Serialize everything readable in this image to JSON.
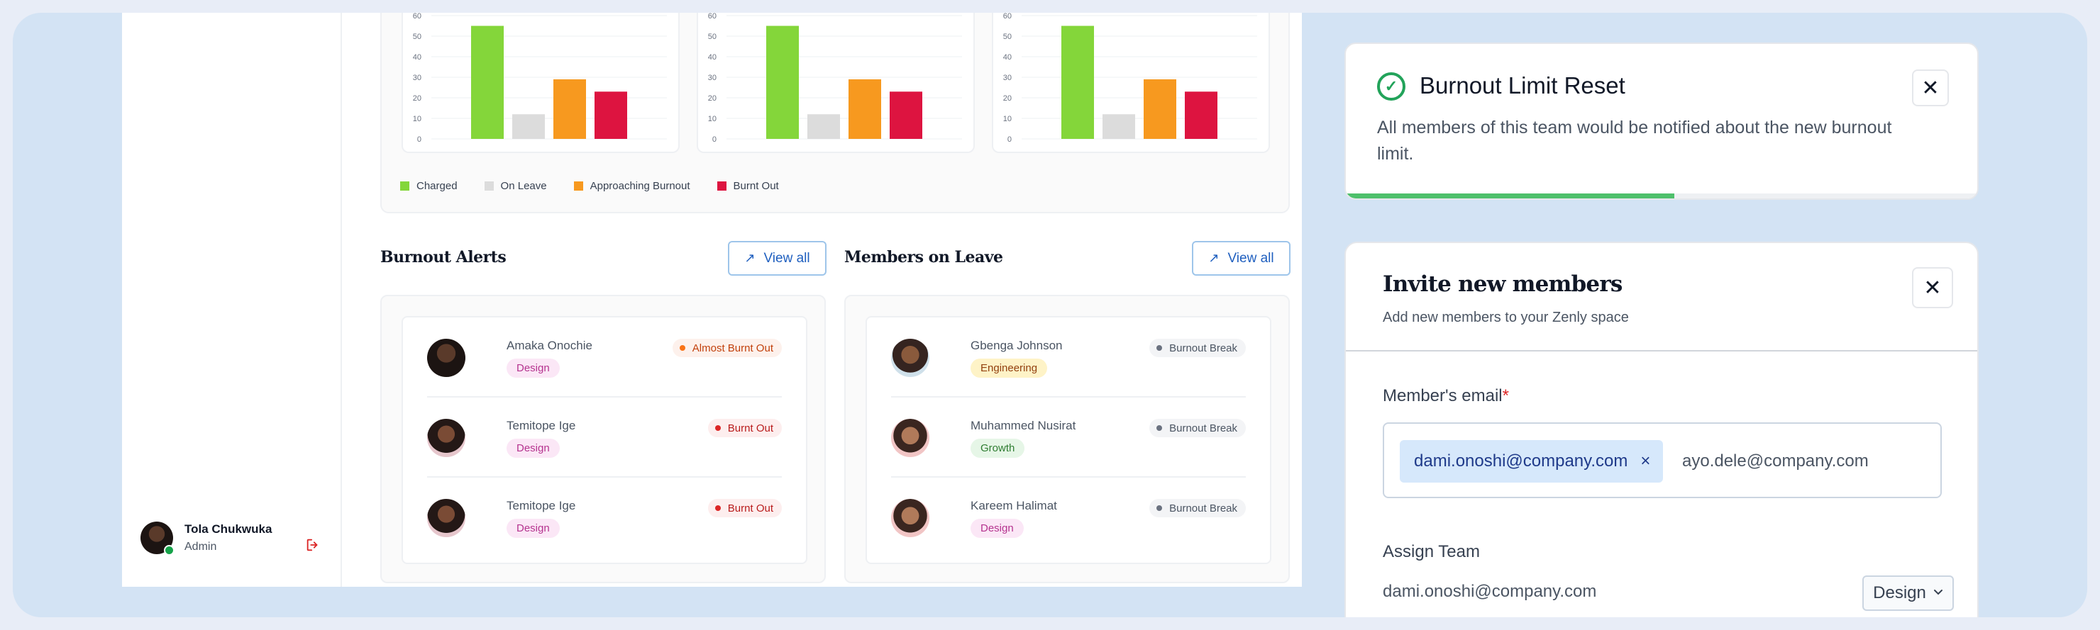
{
  "user": {
    "name": "Tola Chukwuka",
    "role": "Admin",
    "logout_icon": "logout-icon"
  },
  "chart_data": [
    {
      "type": "bar",
      "categories": [
        "Charged",
        "On Leave",
        "Approaching Burnout",
        "Burnt Out"
      ],
      "values": [
        55,
        12,
        29,
        23
      ],
      "yticks": [
        0,
        10,
        20,
        30,
        40,
        50,
        60
      ],
      "ylim": [
        0,
        60
      ],
      "colors": [
        "#84d63a",
        "#dcdcdc",
        "#f7991f",
        "#dd1440"
      ]
    },
    {
      "type": "bar",
      "categories": [
        "Charged",
        "On Leave",
        "Approaching Burnout",
        "Burnt Out"
      ],
      "values": [
        55,
        12,
        29,
        23
      ],
      "yticks": [
        0,
        10,
        20,
        30,
        40,
        50,
        60
      ],
      "ylim": [
        0,
        60
      ],
      "colors": [
        "#84d63a",
        "#dcdcdc",
        "#f7991f",
        "#dd1440"
      ]
    },
    {
      "type": "bar",
      "categories": [
        "Charged",
        "On Leave",
        "Approaching Burnout",
        "Burnt Out"
      ],
      "values": [
        55,
        12,
        29,
        23
      ],
      "yticks": [
        0,
        10,
        20,
        30,
        40,
        50,
        60
      ],
      "ylim": [
        0,
        60
      ],
      "colors": [
        "#84d63a",
        "#dcdcdc",
        "#f7991f",
        "#dd1440"
      ]
    }
  ],
  "legend": [
    {
      "label": "Charged",
      "color": "#84d63a"
    },
    {
      "label": "On Leave",
      "color": "#dcdcdc"
    },
    {
      "label": "Approaching Burnout",
      "color": "#f7991f"
    },
    {
      "label": "Burnt Out",
      "color": "#dd1440"
    }
  ],
  "burnout_alerts": {
    "title": "Burnout Alerts",
    "view_all": "View all",
    "rows": [
      {
        "name": "Amaka Onochie",
        "tag": "Design",
        "status": "Almost Burnt Out"
      },
      {
        "name": "Temitope Ige",
        "tag": "Design",
        "status": "Burnt Out"
      },
      {
        "name": "Temitope Ige",
        "tag": "Design",
        "status": "Burnt Out"
      }
    ]
  },
  "members_on_leave": {
    "title": "Members on Leave",
    "view_all": "View all",
    "rows": [
      {
        "name": "Gbenga Johnson",
        "tag": "Engineering",
        "status": "Burnout Break"
      },
      {
        "name": "Muhammed Nusirat",
        "tag": "Growth",
        "status": "Burnout Break"
      },
      {
        "name": "Kareem Halimat",
        "tag": "Design",
        "status": "Burnout Break"
      }
    ]
  },
  "toast": {
    "title": "Burnout Limit Reset",
    "body": "All members of this team would be notified about the new burnout limit.",
    "progress": 0.52,
    "icon": "check-circle-icon"
  },
  "invite": {
    "title": "Invite new members",
    "subtitle": "Add new members to your Zenly space",
    "email_label": "Member's email",
    "required_mark": "*",
    "chip": "dami.onoshi@company.com",
    "input_value": "ayo.dele@company.com",
    "team_label": "Assign Team",
    "team_email": "dami.onoshi@company.com",
    "team_value": "Design"
  }
}
